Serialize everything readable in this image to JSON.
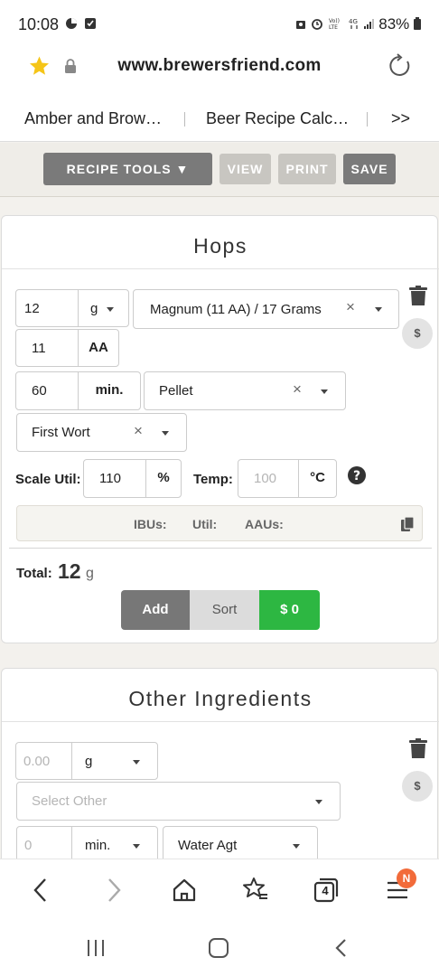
{
  "status_bar": {
    "time": "10:08",
    "battery": "83%"
  },
  "browser": {
    "url": "www.brewersfriend.com",
    "tabs": [
      {
        "label": "Amber and Brow…"
      },
      {
        "label": "Beer Recipe Calc…"
      }
    ],
    "more_tabs_label": ">>",
    "tab_count": "4",
    "menu_badge": "N"
  },
  "toolbar": {
    "recipe_tools": "RECIPE TOOLS ▼",
    "view": "VIEW",
    "print": "PRINT",
    "save": "SAVE"
  },
  "hops": {
    "title": "Hops",
    "amount": "12",
    "unit": "g",
    "variety": "Magnum (11 AA) / 17 Grams",
    "alpha": "11",
    "alpha_label": "AA",
    "time": "60",
    "time_unit": "min.",
    "form": "Pellet",
    "use": "First Wort",
    "scale_util_label": "Scale Util:",
    "scale_util_value": "110",
    "scale_util_unit": "%",
    "temp_label": "Temp:",
    "temp_placeholder": "100",
    "temp_unit": "°C",
    "help": "?",
    "info_ibus": "IBUs:",
    "info_util": "Util:",
    "info_aaus": "AAUs:",
    "total_label": "Total:",
    "total_value": "12",
    "total_unit": "g",
    "add_label": "Add",
    "sort_label": "Sort",
    "cost_label": "$ 0",
    "dollar": "$"
  },
  "other": {
    "title": "Other Ingredients",
    "amount_placeholder": "0.00",
    "unit": "g",
    "select_placeholder": "Select Other",
    "time_placeholder": "0",
    "time_unit": "min.",
    "use": "Water Agt",
    "dollar": "$"
  },
  "colors": {
    "dark_button": "#777777",
    "light_button": "#c9c7c2",
    "green": "#2db742",
    "star": "#f5c518",
    "badge": "#f26b3a"
  }
}
